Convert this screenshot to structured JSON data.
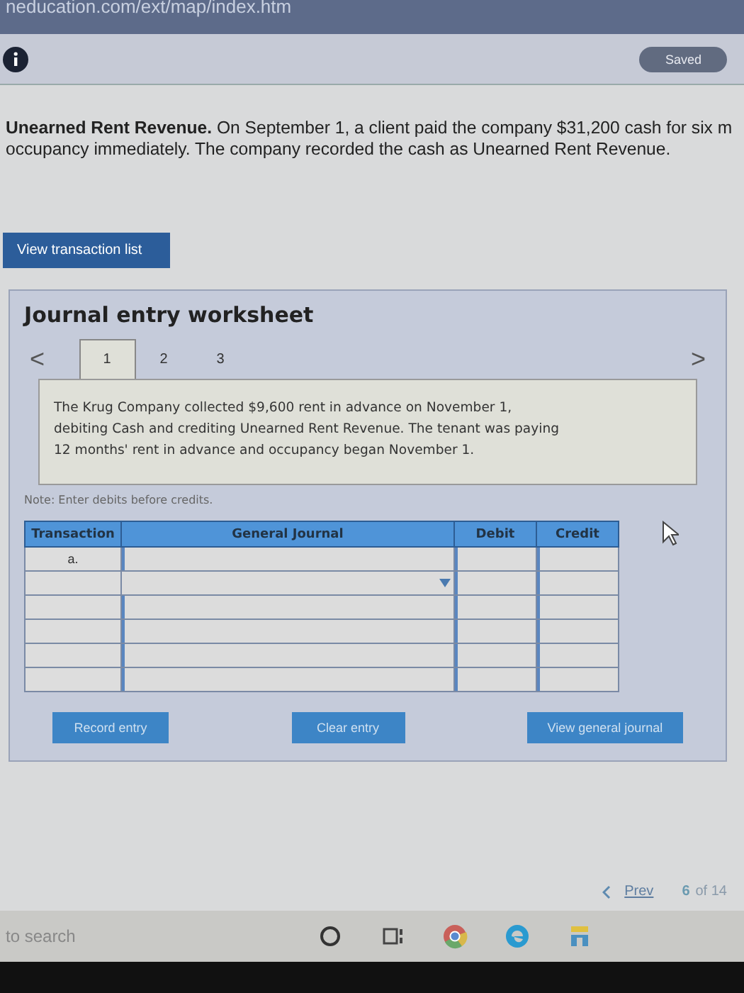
{
  "address_bar": {
    "url": "neducation.com/ext/map/index.htm"
  },
  "header": {
    "status": "Saved"
  },
  "question": {
    "text": "**Unearned Rent Revenue.** On September 1, a client paid the company $31,200 cash for six m",
    "text_line_2": "occupancy immediately. The company recorded the cash as Unearned Rent Revenue."
  },
  "view_transaction_button": "View transaction list",
  "worksheet": {
    "title": "Journal entry worksheet",
    "prev": "<",
    "next": ">",
    "tabs": [
      {
        "label": "1",
        "selected": true
      },
      {
        "label": "2",
        "selected": false
      },
      {
        "label": "3",
        "selected": false
      }
    ],
    "description": "The Krug Company collected $9,600 rent in advance on November 1, debiting Cash and crediting Unearned Rent Revenue. The tenant was paying 12 months' rent in advance and occupancy began November 1.",
    "note": "Note: Enter debits before credits.",
    "table": {
      "columns": [
        "Transaction",
        "General Journal",
        "Debit",
        "Credit"
      ],
      "rows": [
        {
          "transaction": "a.",
          "kind": "input"
        },
        {
          "kind": "dropdown"
        },
        {
          "kind": "input"
        },
        {
          "kind": "input"
        },
        {
          "kind": "input"
        },
        {
          "kind": "input"
        }
      ]
    },
    "buttons": [
      "Record entry",
      "Clear entry",
      "View general journal"
    ]
  },
  "pager": {
    "prev": "Prev",
    "current": "6",
    "of": "of 14"
  },
  "taskbar": {
    "search_placeholder": "to search"
  }
}
